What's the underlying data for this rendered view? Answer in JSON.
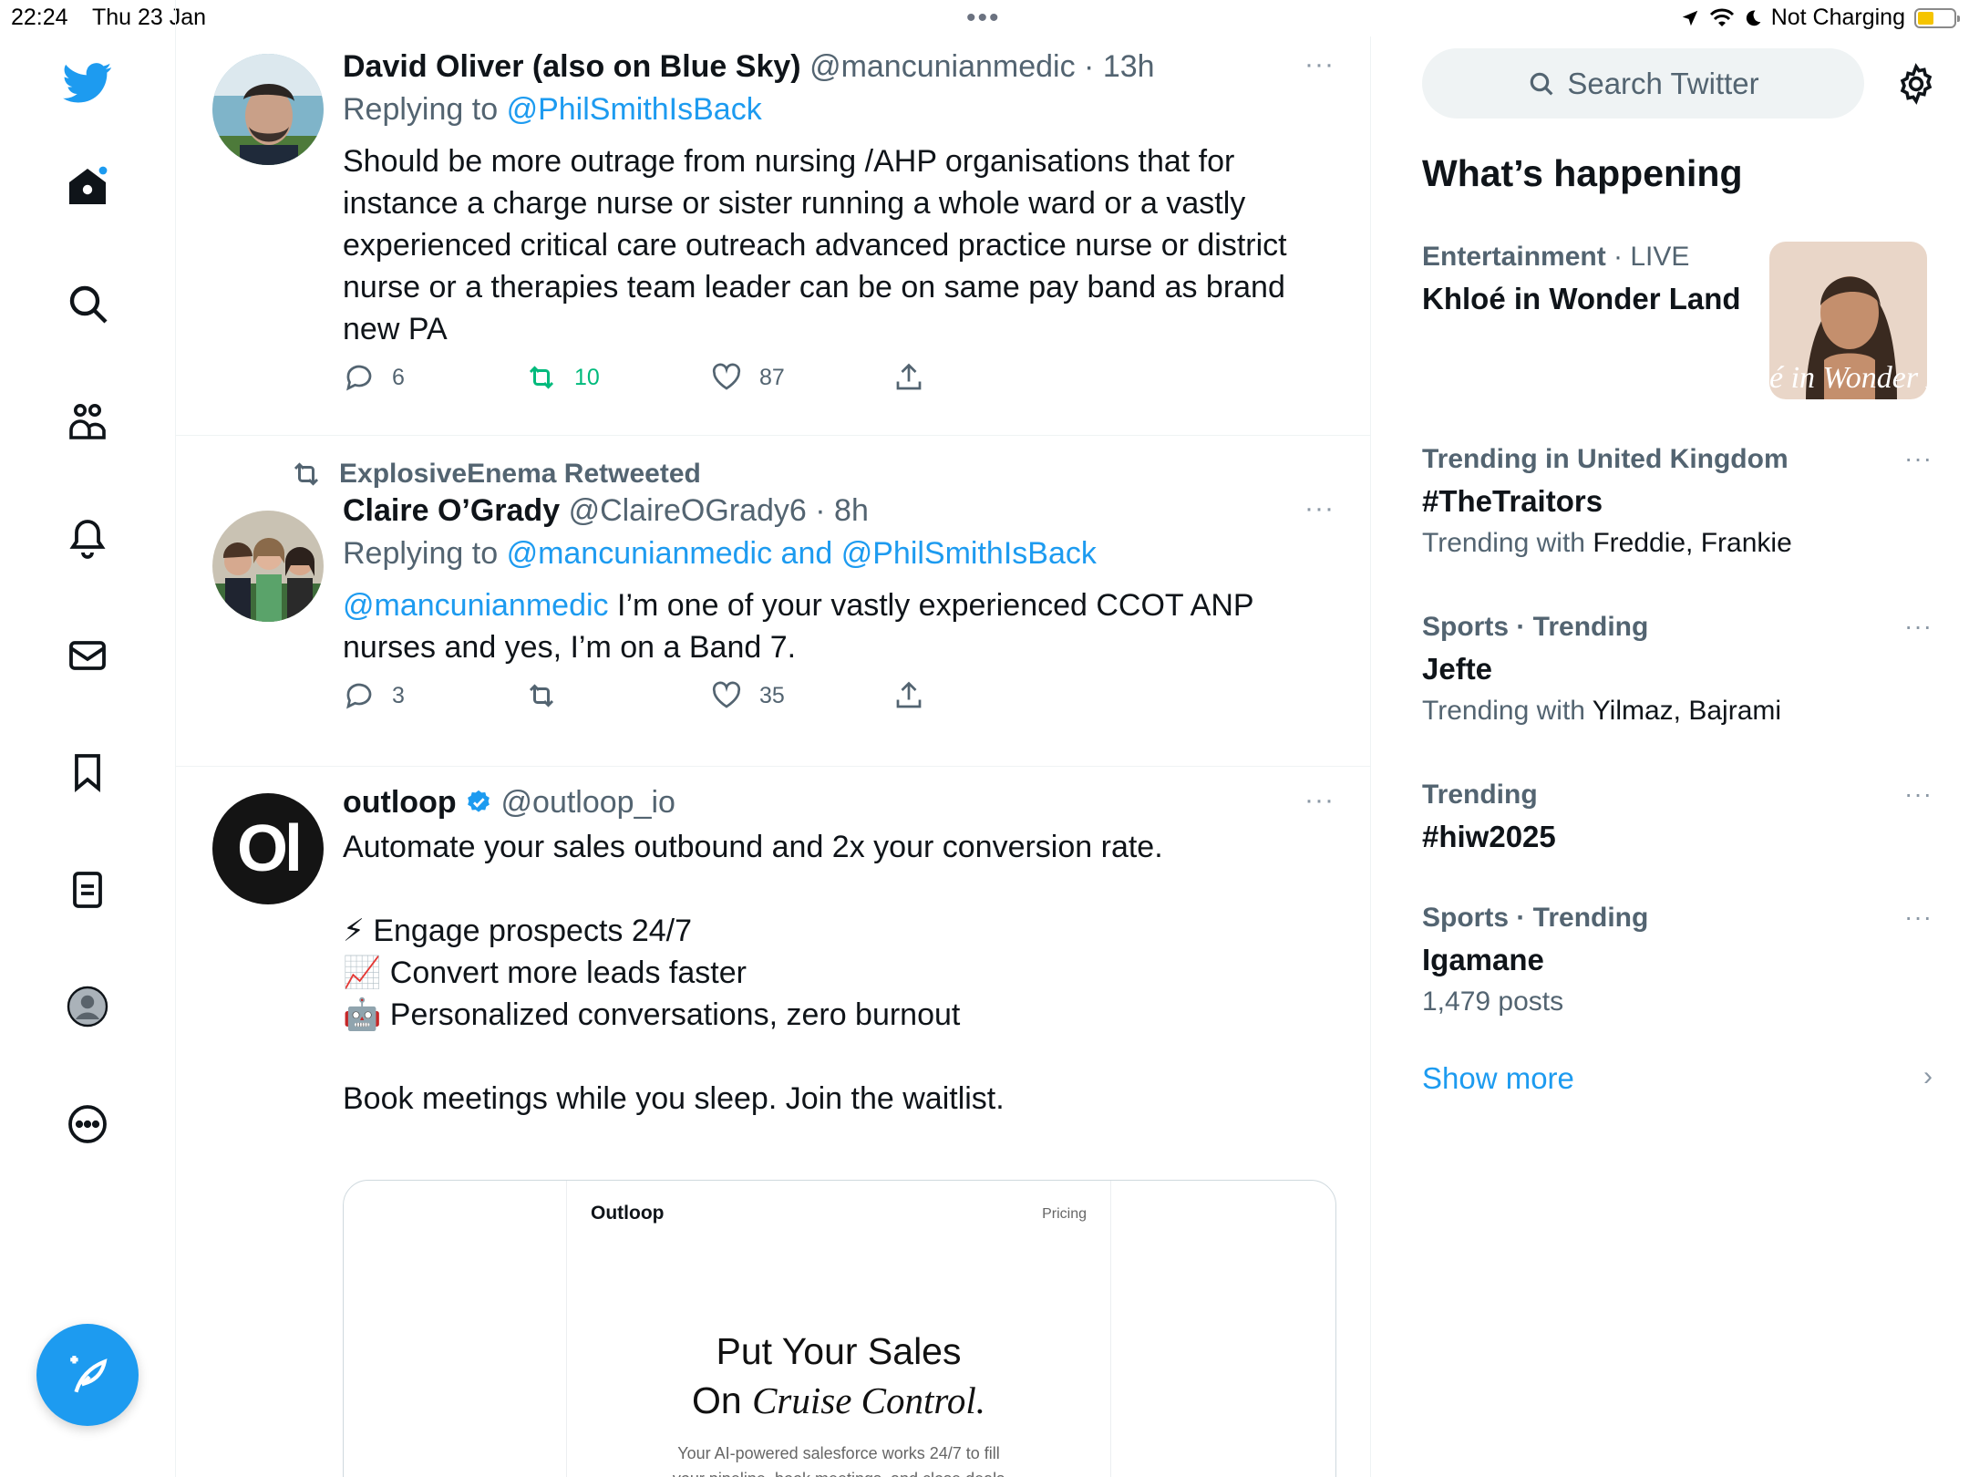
{
  "status_bar": {
    "time": "22:24",
    "date": "Thu 23 Jan",
    "charging": "Not Charging",
    "multitask_dots": "•••"
  },
  "nav": {
    "icons": [
      "twitter-bird-icon",
      "home-icon",
      "search-icon",
      "communities-icon",
      "notifications-icon",
      "messages-icon",
      "bookmarks-icon",
      "lists-icon",
      "profile-icon",
      "more-icon"
    ],
    "compose_icon": "compose-icon"
  },
  "feed": {
    "tweets": [
      {
        "name": "David Oliver (also on Blue Sky)",
        "handle": "@mancunianmedic",
        "time": "13h",
        "replying_label": "Replying to",
        "replying_to": "@PhilSmithIsBack",
        "text": "Should be more outrage from nursing /AHP  organisations that for instance a charge nurse or sister running a whole ward or a vastly experienced critical care outreach advanced practice nurse or district nurse or a therapies team leader can be on same pay band as brand new PA",
        "replies": "6",
        "retweets": "10",
        "likes": "87",
        "more": "···"
      },
      {
        "retweeted_by": "ExplosiveEnema Retweeted",
        "name": "Claire O’Grady",
        "handle": "@ClaireOGrady6",
        "time": "8h",
        "replying_label": "Replying to",
        "replying_to": "@mancunianmedic and @PhilSmithIsBack",
        "mention": "@mancunianmedic",
        "text": " I’m one of your vastly experienced CCOT ANP nurses and yes, I’m on a Band 7.",
        "replies": "3",
        "retweets": "",
        "likes": "35",
        "more": "···"
      },
      {
        "name": "outloop",
        "handle": "@outloop_io",
        "avatar_text": "Ol",
        "line1": "Automate your sales outbound and 2x your conversion rate.",
        "bullet1": "⚡ Engage prospects 24/7",
        "bullet2": "📈 Convert more leads faster",
        "bullet3": "🤖 Personalized conversations, zero burnout",
        "line2": "Book meetings while you sleep. Join the waitlist.",
        "more": "···",
        "card": {
          "brand": "Outloop",
          "pricing": "Pricing",
          "headline1": "Put Your Sales",
          "headline2a": "On ",
          "headline2b": "Cruise Control.",
          "sub1": "Your AI-powered salesforce works 24/7 to fill",
          "sub2": "your pipeline, book meetings, and close deals"
        }
      }
    ]
  },
  "sidebar": {
    "search_placeholder": "Search Twitter",
    "title": "What’s happening",
    "trends": [
      {
        "meta": "Entertainment",
        "live": "LIVE",
        "title": "Khloé in Wonder Land",
        "thumb_text": "é in Wonder L"
      },
      {
        "meta": "Trending in United Kingdom",
        "title": "#TheTraitors",
        "sub_label": "Trending with",
        "sub_value": "Freddie, Frankie",
        "more": "···"
      },
      {
        "meta": "Sports · Trending",
        "title": "Jefte",
        "sub_label": "Trending with",
        "sub_value": "Yilmaz, Bajrami",
        "more": "···"
      },
      {
        "meta": "Trending",
        "title": "#hiw2025",
        "more": "···"
      },
      {
        "meta": "Sports · Trending",
        "title": "Igamane",
        "sub_label": "1,479 posts",
        "more": "···"
      }
    ],
    "show_more": "Show more",
    "show_more_chevron": "›"
  },
  "colors": {
    "accent": "#1d9bf0",
    "retweet_green": "#00ba7c",
    "secondary_text": "#536471"
  }
}
